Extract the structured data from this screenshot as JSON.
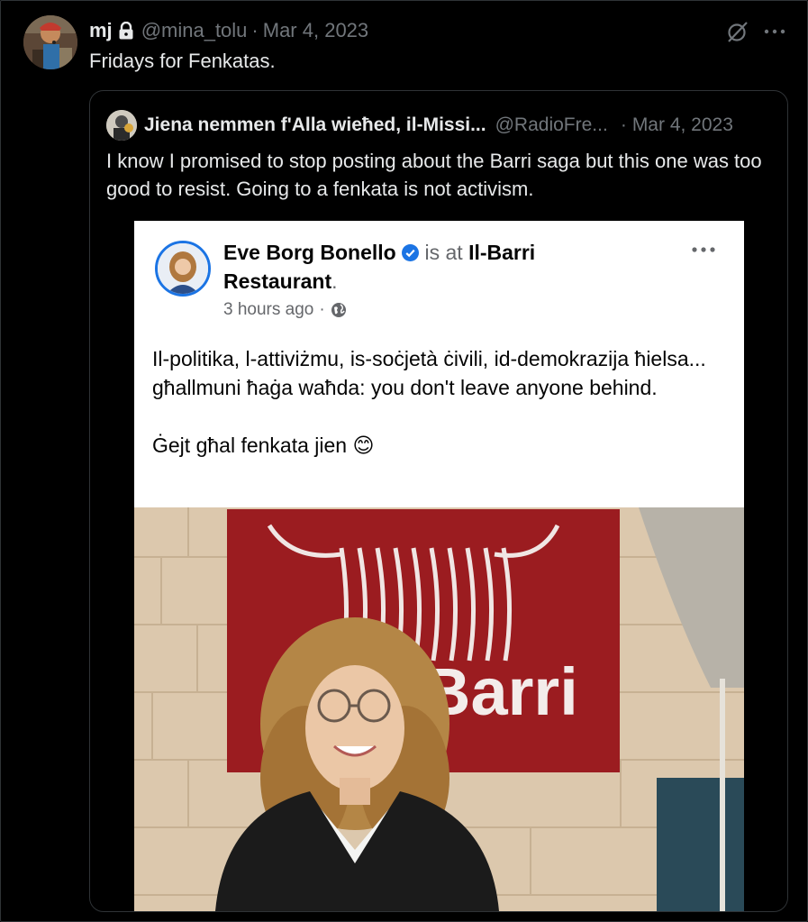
{
  "tweet": {
    "author_name": "mj",
    "handle": "@mina_tolu",
    "separator": "·",
    "date": "Mar 4, 2023",
    "text": "Fridays for Fenkatas.",
    "icons": {
      "lock": "lock-icon",
      "grok": "grok-icon",
      "more": "more-icon"
    }
  },
  "quoted": {
    "author_name": "Jiena nemmen f'Alla wieħed, il-Missi...",
    "handle": "@RadioFre...",
    "separator": "·",
    "date": "Mar 4, 2023",
    "text": "I know I promised to stop posting about the Barri saga but this one was too good to resist. Going to a fenkata is not activism."
  },
  "fb_post": {
    "author": "Eve Borg Bonello",
    "is_at": "is at",
    "place": "Il-Barri Restaurant",
    "period": ".",
    "time": "3 hours ago",
    "time_sep": "·",
    "body_line1": "Il-politika, l-attiviżmu, is-soċjetà ċivili, id-demokrazija ħielsa... għallmuni ħaġa waħda: you don't leave anyone behind.",
    "body_line2": "Ġejt għal fenkata jien",
    "emoji": "😊",
    "colors": {
      "verified": "#1b74e4",
      "name": "#050505",
      "meta": "#65676b"
    }
  },
  "photo": {
    "sign_text": "Barri",
    "sign_color": "#9b1c20"
  },
  "colors": {
    "background": "#000000",
    "text": "#e7e9ea",
    "muted": "#71767b",
    "border": "#2f3336"
  }
}
